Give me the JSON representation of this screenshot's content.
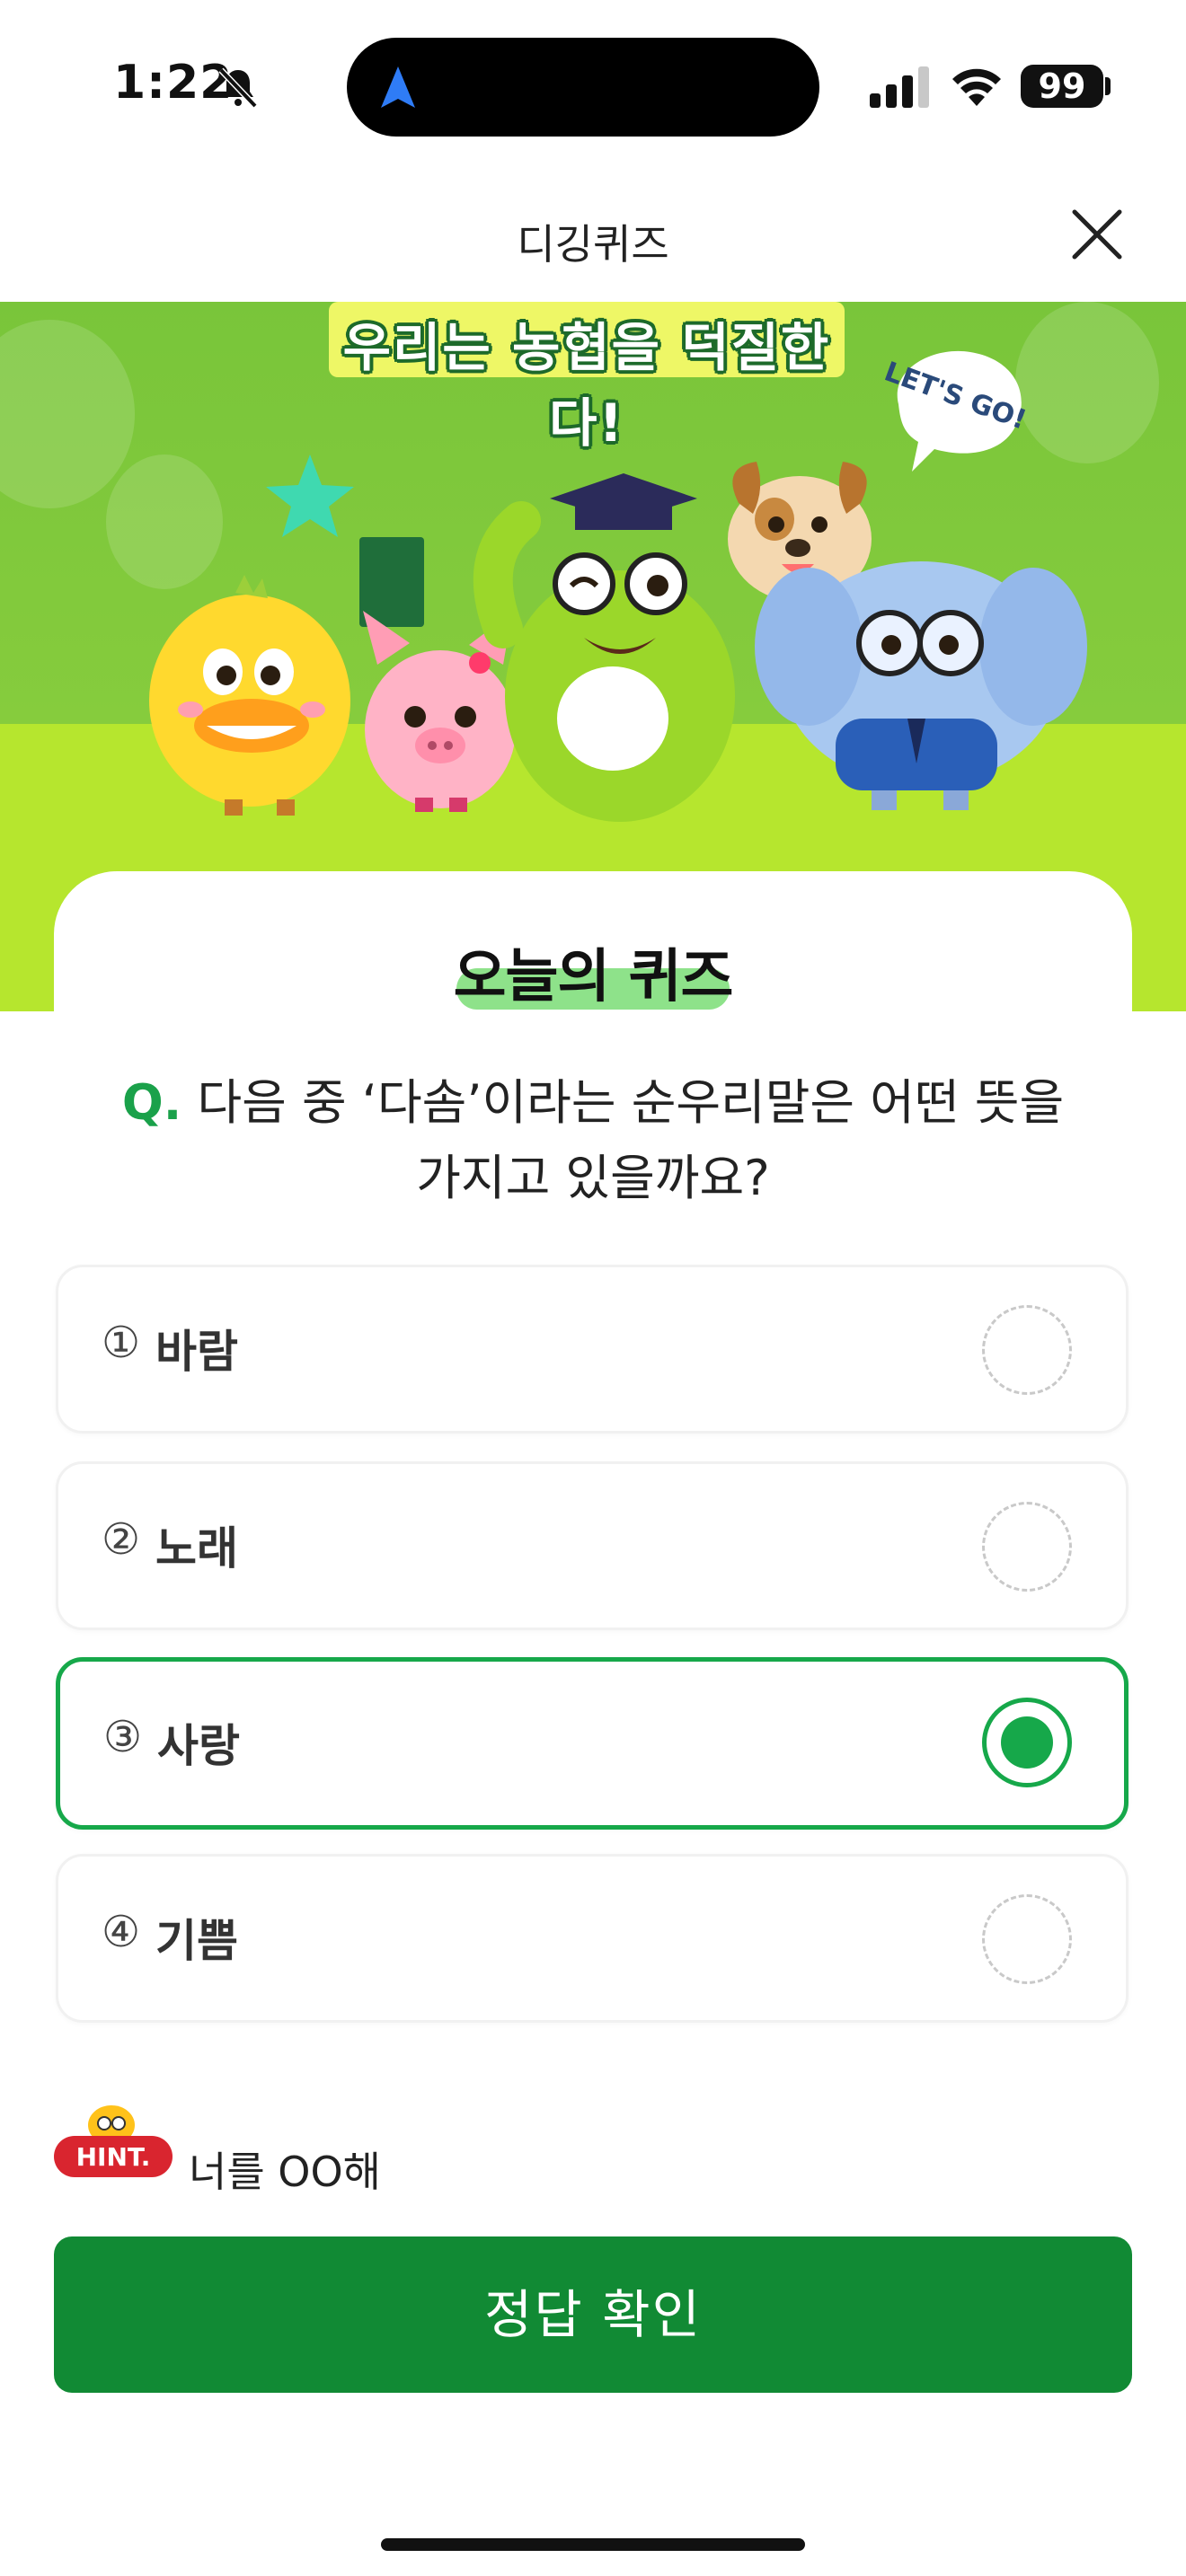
{
  "status_bar": {
    "time": "1:22",
    "battery": "99"
  },
  "header": {
    "title": "디깅퀴즈",
    "close_icon": "close-icon"
  },
  "banner": {
    "title": "우리는 농협을 덕질한다!",
    "sticker": "LET'S GO!"
  },
  "quiz": {
    "label": "오늘의 퀴즈",
    "question_mark": "Q.",
    "question": "다음 중 ‘다솜’이라는 순우리말은 어떤 뜻을 가지고 있을까요?",
    "options": [
      {
        "num": "①",
        "label": "바람",
        "selected": false
      },
      {
        "num": "②",
        "label": "노래",
        "selected": false
      },
      {
        "num": "③",
        "label": "사랑",
        "selected": true
      },
      {
        "num": "④",
        "label": "기쁨",
        "selected": false
      }
    ]
  },
  "hint": {
    "badge": "HINT.",
    "text": "너를 OO해"
  },
  "submit": {
    "label": "정답 확인"
  },
  "colors": {
    "accent": "#118a34",
    "selected": "#16a84a",
    "banner_green": "#86cc3d",
    "banner_lime": "#b6e62e",
    "hint_red": "#d9252f"
  }
}
